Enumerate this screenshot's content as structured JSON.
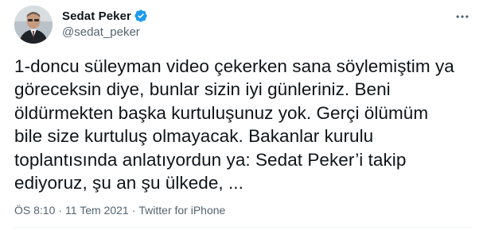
{
  "author": {
    "display_name": "Sedat Peker",
    "handle": "@sedat_peker",
    "avatar": "avatar-photo",
    "verified": true,
    "verified_icon": "verified-badge-icon"
  },
  "tweet": {
    "text": "1-doncu süleyman video çekerken sana söylemiştim ya\ngöreceksin diye, bunlar sizin iyi günleriniz. Beni\nöldürmekten başka kurtuluşunuz yok. Gerçi ölümüm\nbile size kurtuluş olmayacak. Bakanlar kurulu\ntoplantısında anlatıyordun ya: Sedat Peker’i takip\nediyoruz, şu an şu ülkede, ...",
    "time": "ÖS 8:10",
    "date": "11 Tem 2021",
    "source": "Twitter for iPhone",
    "separator": "·"
  },
  "icons": {
    "more": "more-options-icon"
  },
  "colors": {
    "verified": "#1d9bf0",
    "text": "#0f1419",
    "muted": "#536471"
  }
}
